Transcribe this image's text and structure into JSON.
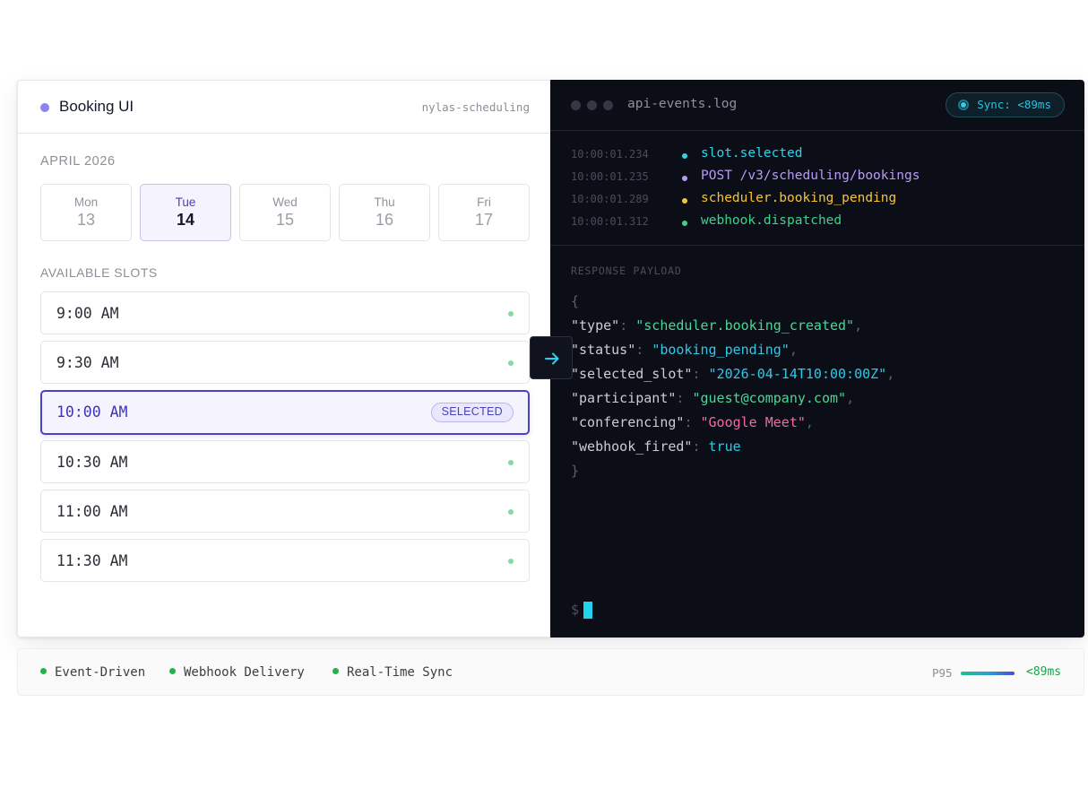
{
  "booking": {
    "title": "Booking UI",
    "tag": "nylas-scheduling",
    "month": "APRIL 2026",
    "days": [
      {
        "name": "Mon",
        "num": "13"
      },
      {
        "name": "Tue",
        "num": "14"
      },
      {
        "name": "Wed",
        "num": "15"
      },
      {
        "name": "Thu",
        "num": "16"
      },
      {
        "name": "Fri",
        "num": "17"
      }
    ],
    "selected_day": "Tue",
    "slots_heading": "AVAILABLE SLOTS",
    "slots": [
      "9:00 AM",
      "9:30 AM",
      "10:00 AM",
      "10:30 AM",
      "11:00 AM",
      "11:30 AM"
    ],
    "selected_slot": "10:00 AM",
    "selected_badge": "SELECTED",
    "colors": {
      "accent": "#4a42c0",
      "available_dot": "#86d9a0"
    }
  },
  "console": {
    "file": "api-events.log",
    "sync_label": "Sync: <89ms",
    "events": [
      {
        "ts": "10:00:01.234",
        "msg": "slot.selected",
        "color": "#2fd3e8"
      },
      {
        "ts": "10:00:01.235",
        "msg": "POST /v3/scheduling/bookings",
        "color": "#b79cf5"
      },
      {
        "ts": "10:00:01.289",
        "msg": "scheduler.booking_pending",
        "color": "#f6c431"
      },
      {
        "ts": "10:00:01.312",
        "msg": "webhook.dispatched",
        "color": "#3fd38a"
      }
    ],
    "payload_heading": "RESPONSE PAYLOAD",
    "payload": {
      "open": "{",
      "close": "}",
      "fields": [
        {
          "key": "\"type\"",
          "value": "\"scheduler.booking_created\"",
          "style": "green",
          "comma": ","
        },
        {
          "key": "\"status\"",
          "value": "\"booking_pending\"",
          "style": "cyan",
          "comma": ","
        },
        {
          "key": "\"selected_slot\"",
          "value": "\"2026-04-14T10:00:00Z\"",
          "style": "cyan",
          "comma": ","
        },
        {
          "key": "\"participant\"",
          "value": "\"guest@company.com\"",
          "style": "green",
          "comma": ","
        },
        {
          "key": "\"conferencing\"",
          "value": "\"Google Meet\"",
          "style": "pink",
          "comma": ","
        },
        {
          "key": "\"webhook_fired\"",
          "value": "true",
          "style": "cyan",
          "comma": ""
        }
      ]
    },
    "prompt": "$"
  },
  "footer": {
    "features": [
      "Event-Driven",
      "Webhook Delivery",
      "Real-Time Sync"
    ],
    "p95_label": "P95",
    "latency": "<89ms"
  }
}
